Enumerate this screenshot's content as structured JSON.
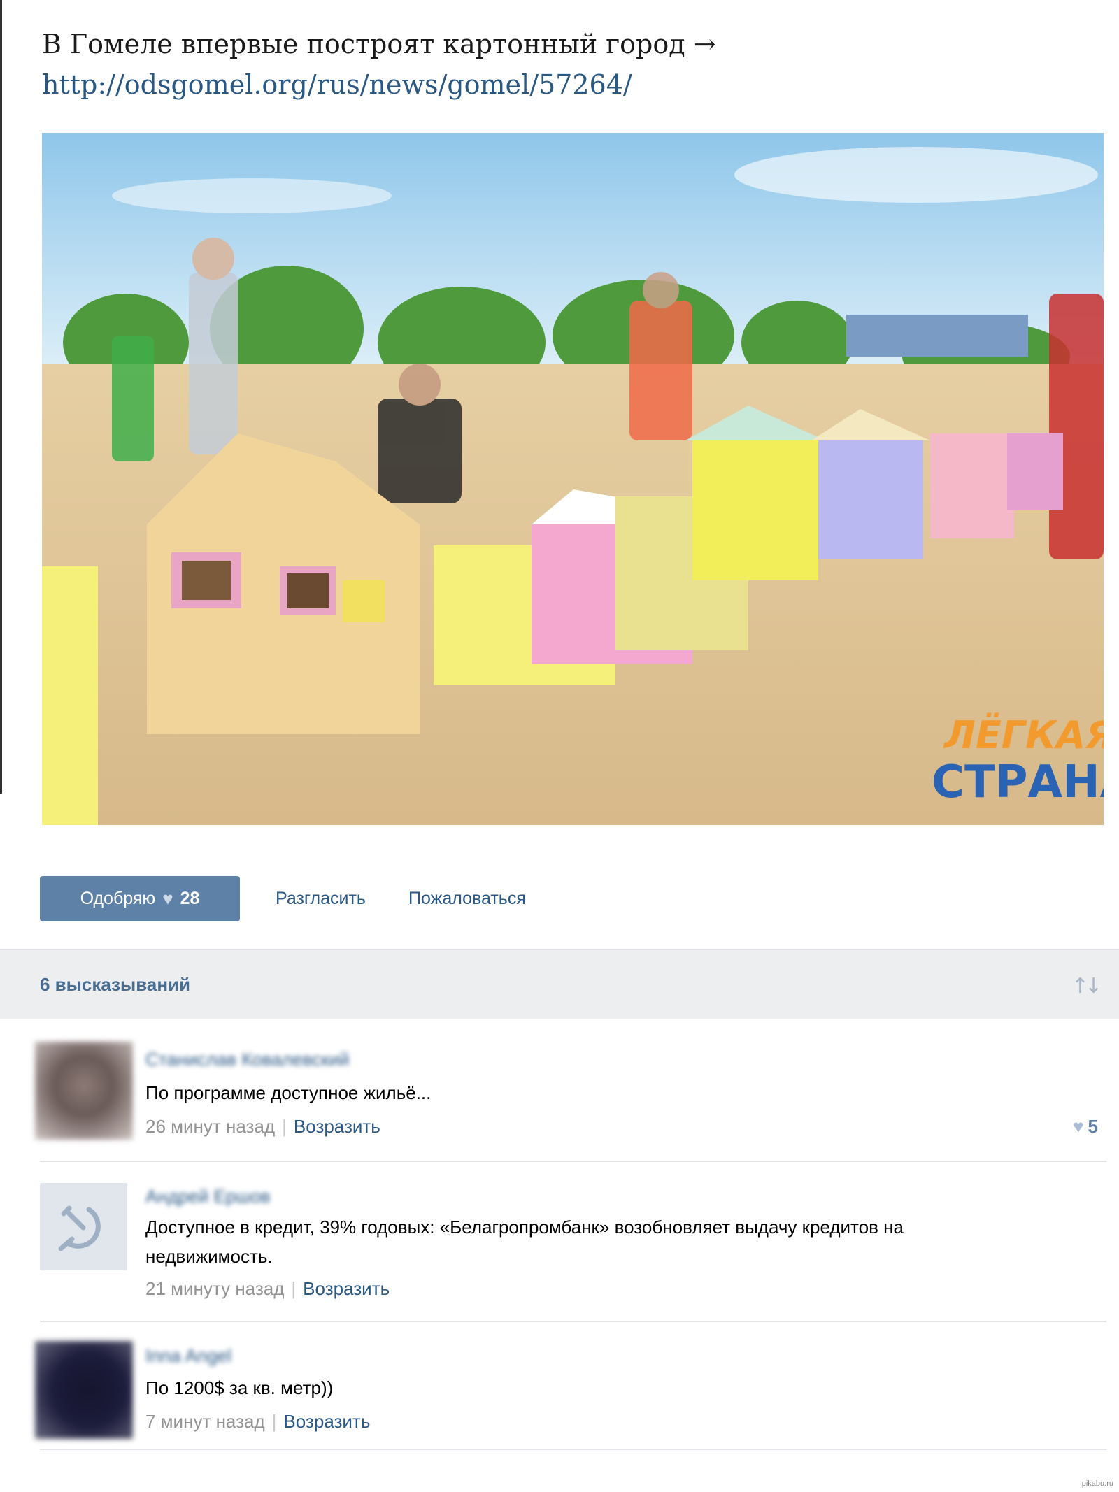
{
  "post": {
    "title": "В Гомеле впервые построят картонный город →",
    "link": "http://odsgomel.org/rus/news/gomel/57264/",
    "photo_caption_logo": [
      "ЛЁГКАЯ",
      "СТРАНА"
    ]
  },
  "actions": {
    "like_label": "Одобряю",
    "like_count": "28",
    "share_label": "Разгласить",
    "report_label": "Пожаловаться"
  },
  "comments_header": {
    "count_label": "6 высказываний"
  },
  "comments": [
    {
      "author": "Станислав Ковалевский",
      "text": "По программе доступное жильё...",
      "time": "26 минут назад",
      "reply_label": "Возразить",
      "likes": "5"
    },
    {
      "author": "Андрей Ершов",
      "text": "Доступное в кредит, 39% годовых: «Белагропромбанк» возобновляет выдачу кредитов на недвижимость.",
      "time": "21 минуту назад",
      "reply_label": "Возразить"
    },
    {
      "author": "Inna Angel",
      "text": "По 1200$ за кв. метр))",
      "time": "7 минут назад",
      "reply_label": "Возразить"
    }
  ],
  "colors": {
    "link": "#2a5885",
    "button": "#5e81a8",
    "bar": "#edeef0"
  },
  "watermark": "pikabu.ru"
}
